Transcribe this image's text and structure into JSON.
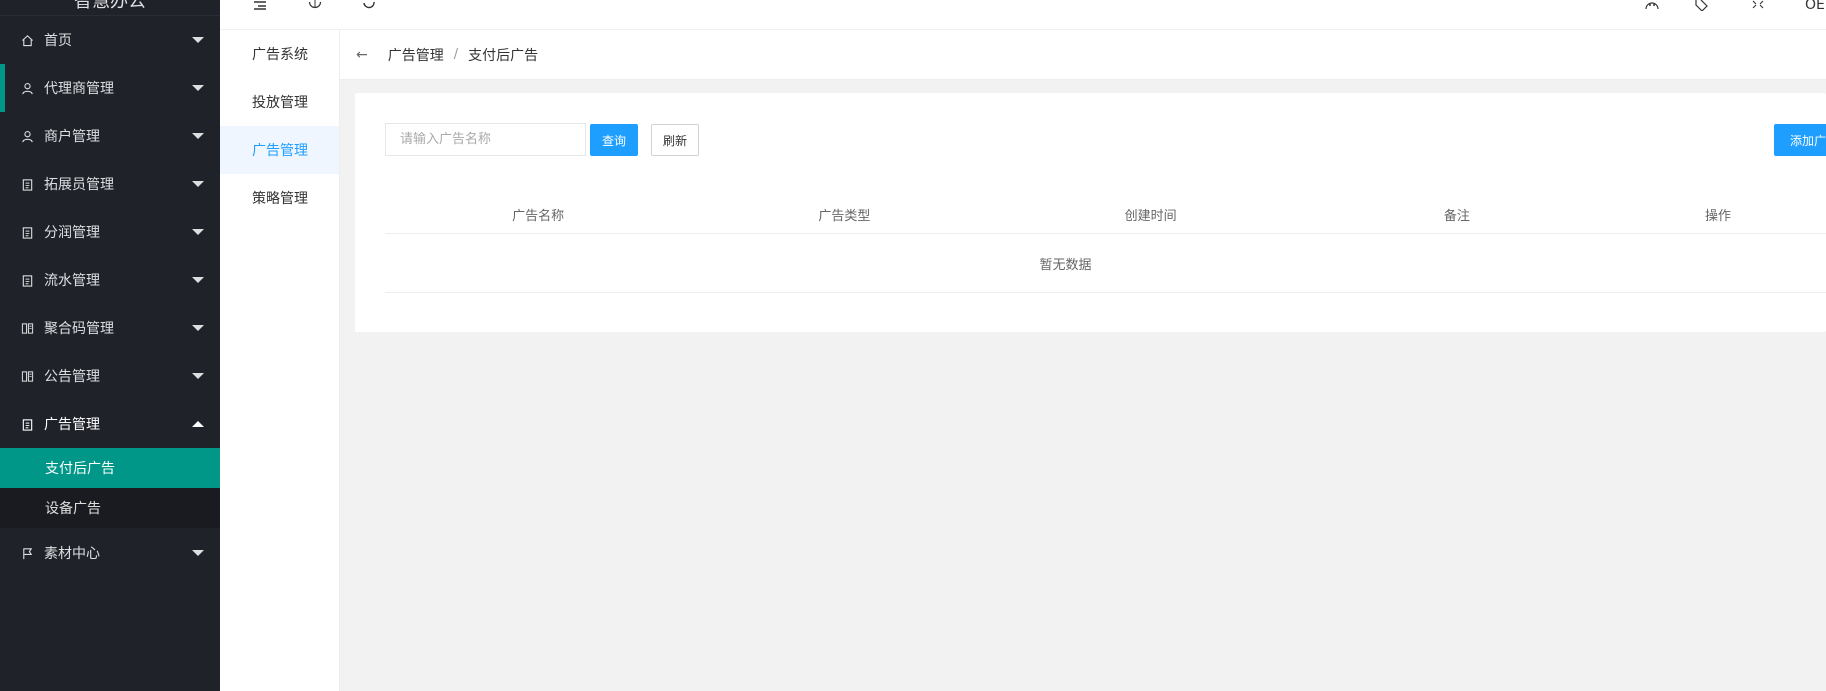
{
  "sidebar": {
    "brand": "智慧办公",
    "items": [
      {
        "label": "首页",
        "icon": "home-icon"
      },
      {
        "label": "代理商管理",
        "icon": "user-icon"
      },
      {
        "label": "商户管理",
        "icon": "user-icon"
      },
      {
        "label": "拓展员管理",
        "icon": "clipboard-icon"
      },
      {
        "label": "分润管理",
        "icon": "clipboard-icon"
      },
      {
        "label": "流水管理",
        "icon": "clipboard-icon"
      },
      {
        "label": "聚合码管理",
        "icon": "reader-icon"
      },
      {
        "label": "公告管理",
        "icon": "reader-icon"
      },
      {
        "label": "广告管理",
        "icon": "clipboard-icon"
      }
    ],
    "submenu": [
      {
        "label": "支付后广告"
      },
      {
        "label": "设备广告"
      }
    ],
    "last_item": {
      "label": "素材中心",
      "icon": "flag-icon"
    }
  },
  "header": {
    "user_label": "OE"
  },
  "subnav": {
    "items": [
      {
        "label": "广告系统"
      },
      {
        "label": "投放管理"
      },
      {
        "label": "广告管理"
      },
      {
        "label": "策略管理"
      }
    ]
  },
  "breadcrumb": {
    "items": [
      "广告管理",
      "支付后广告"
    ],
    "separator": "/"
  },
  "toolbar": {
    "search_placeholder": "请输入广告名称",
    "query_label": "查询",
    "refresh_label": "刷新",
    "add_label": "添加广告"
  },
  "table": {
    "columns": [
      "广告名称",
      "广告类型",
      "创建时间",
      "备注",
      "操作"
    ],
    "empty_text": "暂无数据"
  },
  "colors": {
    "sidebar_bg": "#20222a",
    "accent": "#009688",
    "primary": "#1e9fff"
  }
}
